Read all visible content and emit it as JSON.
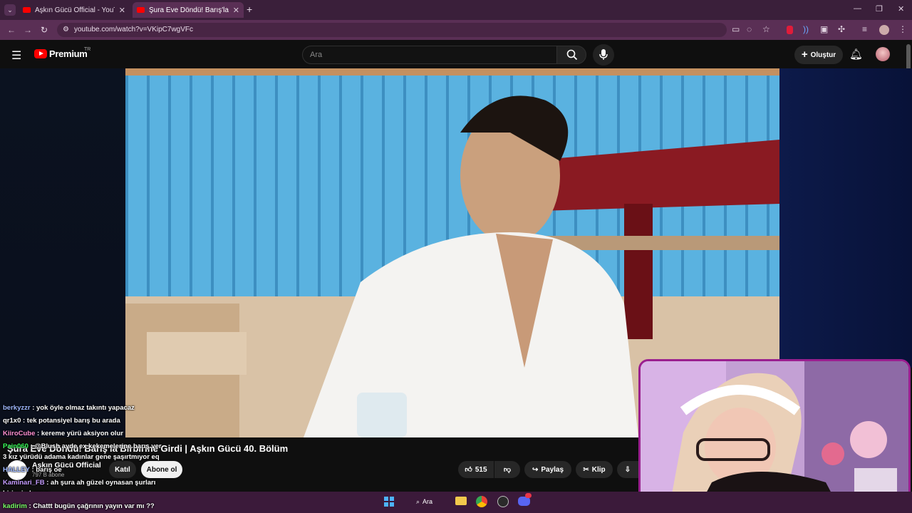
{
  "tabs": [
    {
      "label": "Aşkın Gücü Official - YouTube"
    },
    {
      "label": "Şura Eve Döndü! Barış'la Birbirine"
    }
  ],
  "address": {
    "url": "youtube.com/watch?v=VKipC7wgVFc"
  },
  "youtube": {
    "logo_text": "Premium",
    "region": "TR",
    "search_placeholder": "Ara",
    "create_label": "Oluştur"
  },
  "video": {
    "title": "Şura Eve Döndü! Barış'la Birbirine Girdi | Aşkın Gücü 40. Bölüm",
    "channel_name": "Aşkın Gücü Official",
    "subscribers": "797 B abone",
    "join_label": "Katıl",
    "subscribe_label": "Abone ol",
    "likes": "515",
    "share_label": "Paylaş",
    "clip_label": "Klip"
  },
  "chat": [
    {
      "user": "berkyzzr",
      "text": ": yok öyle olmaz takıntı yapacaz",
      "color": "#9fb8ff"
    },
    {
      "user": "qr1x0",
      "text": ": tek potansiyel barış bu arada",
      "color": "#ffffff"
    },
    {
      "user": "KiiroCube",
      "text": ": kereme yürü aksiyon olur",
      "color": "#ff8fd0"
    },
    {
      "user": "Pain060",
      "text": ": @Blush ayde ex kekemelerine barış ver",
      "color": "#39ff5a"
    },
    {
      "user": "",
      "text": "3 kız yürüdü adama kadınlar gene şaşırtmıyor eq",
      "color": "#ffffff"
    },
    {
      "user": "HALLEY",
      "text": ": barış oe",
      "color": "#9fb8ff"
    },
    {
      "user": "Kaminari_FB",
      "text": ": ah şura ah güzel oynasan şurları",
      "color": "#c59cff"
    },
    {
      "user": "",
      "text": "birinci olursun",
      "color": "#ffffff"
    },
    {
      "user": "kadirim",
      "text": ": Chattt bugün çağrının yayın var mı ??",
      "color": "#7cff6a"
    }
  ],
  "taskbar": {
    "search_label": "Ara"
  },
  "colors": {
    "accent": "#ff0000",
    "browser": "#5a2f55",
    "cam_border": "#9a1f8f"
  }
}
